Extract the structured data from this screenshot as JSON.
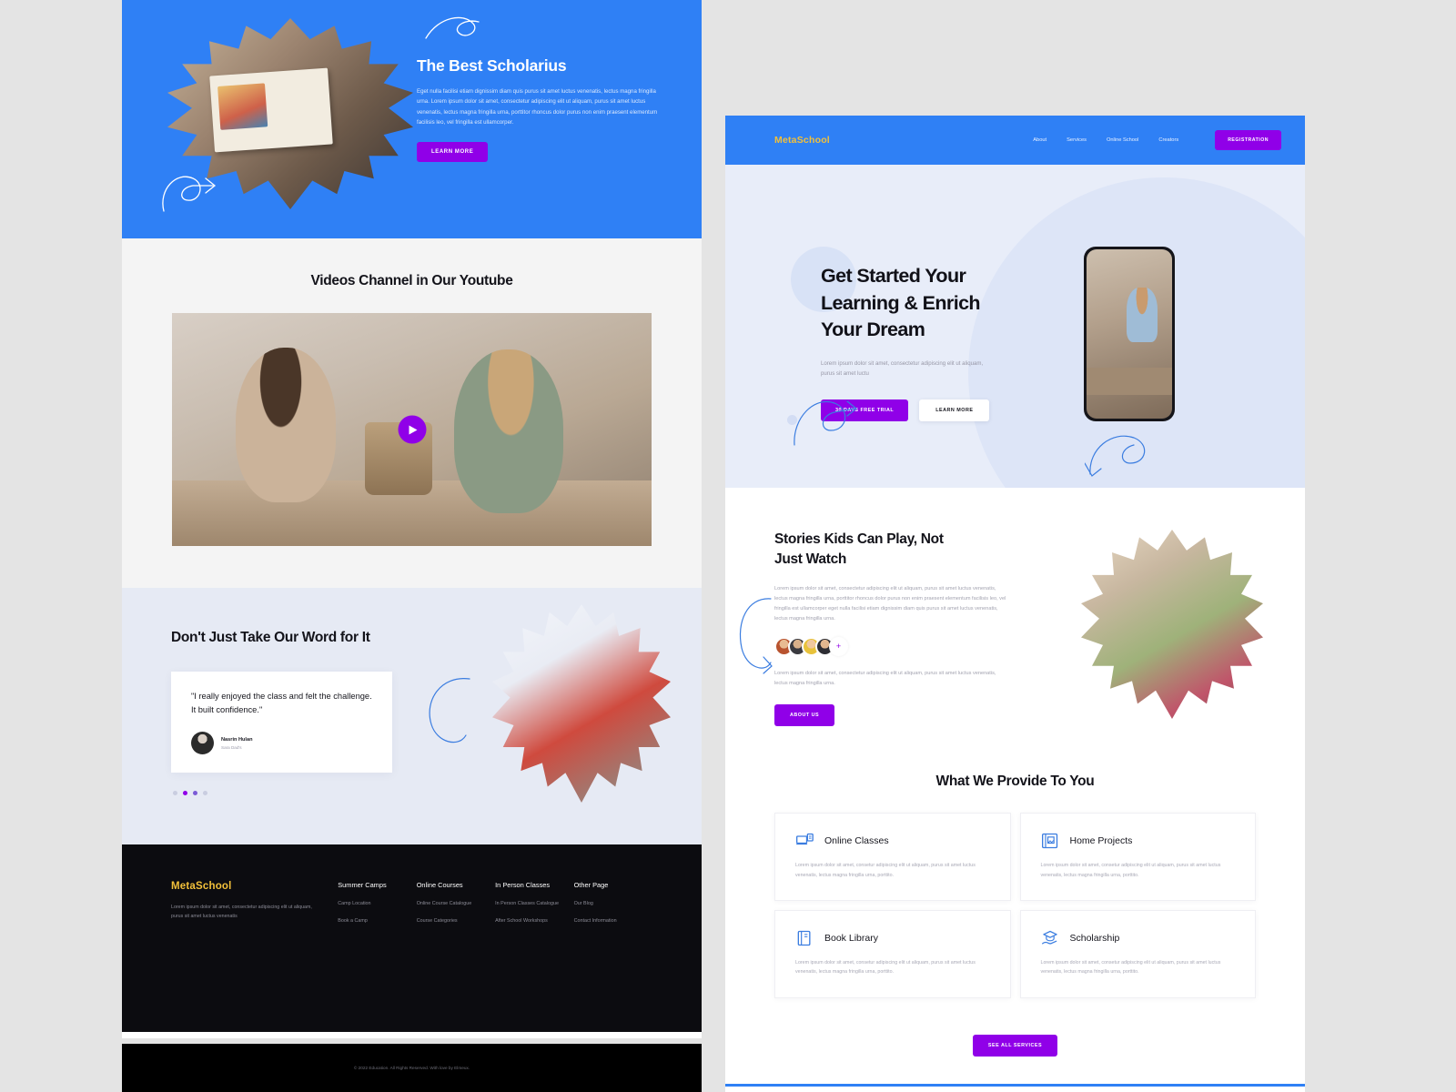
{
  "brand": {
    "name": "MetaSchool",
    "accent_yellow": "#f2c03a",
    "blue": "#2f80f5",
    "purple": "#9000e8"
  },
  "left_page": {
    "hero": {
      "title": "The Best Scholarius",
      "body": "Eget nulla facilisi etiam dignissim diam quis purus sit amet luctus venenatis, lectus magna fringilla urna. Lorem ipsum dolor sit amet, consectetur adipiscing elit ut aliquam, purus sit amet luctus venenatis, lectus magna fringilla urna, porttitor rhoncus dolor purus non enim praesent elementum facilisis leo, vel fringilla est ullamcorper.",
      "cta": "LEARN MORE"
    },
    "videos": {
      "title": "Videos Channel in Our Youtube",
      "play_label": "play-video"
    },
    "testimonials": {
      "title": "Don't Just Take Our\nWord for It",
      "quote": "\"I really enjoyed the class and felt the challenge.  It built confidence.\"",
      "author_name": "Nasrin Hulan",
      "author_role": "Sara Dad's",
      "dots": [
        "inactive",
        "active",
        "mid",
        "inactive"
      ]
    },
    "footer": {
      "brand": "MetaSchool",
      "description": "Lorem ipsum dolor sit amet, consectetur adipiscing elit ut aliquam, purus sit amet luctus venenatis",
      "columns": [
        {
          "title": "Summer Camps",
          "links": [
            "Camp Location",
            "Book a Camp"
          ]
        },
        {
          "title": "Online Courses",
          "links": [
            "Online Course Catalogue",
            "Course Categories"
          ]
        },
        {
          "title": "In Person Classes",
          "links": [
            "In Person Classes Catalogue",
            "After School Workshops"
          ]
        },
        {
          "title": "Other Page",
          "links": [
            "Our Blog",
            "Contact Information"
          ]
        }
      ],
      "copyright": "© 2022 Education. All Rights Reserved. With love by Elmeux."
    }
  },
  "right_page": {
    "nav": {
      "brand": "MetaSchool",
      "links": [
        "About",
        "Services",
        "Online School",
        "Creators"
      ],
      "cta": "REGISTRATION"
    },
    "hero": {
      "title": "Get Started Your Learning & Enrich Your Dream",
      "title_line1": "Get Started Your",
      "title_line2": "Learning & Enrich",
      "title_line3": "Your Dream",
      "sub": "Lorem ipsum dolor sit amet, consectetur adipiscing elit ut aliquam, purus sit amet luctu",
      "cta_primary": "30 DAYS FREE TRIAL",
      "cta_secondary": "LEARN MORE"
    },
    "stories": {
      "title_line1": "Stories Kids Can Play, Not",
      "title_line2": "Just Watch",
      "paragraph1": "Lorem ipsum dolor sit amet, consectetur adipiscing elit ut aliquam, purus sit amet luctus venenatis, lectus magna fringilla urna, porttitor rhoncus dolor purus non enim praesent elementum facilisis leo, vel fringilla est ullamcorper eget nulla facilisi etiam dignissim diam quis purus sit amet luctus venenatis, lectus magna fringilla urna.",
      "paragraph2": "Lorem ipsum dolor sit amet, consectetur adipiscing elit ut aliquam, purus sit amet luctus venenatis, lectus magna fringilla urna.",
      "avatar_more": "+",
      "cta": "ABOUT US"
    },
    "provide": {
      "title": "What We Provide To You",
      "cards": [
        {
          "icon": "laptop-classes-icon",
          "title": "Online Classes",
          "body": "Lorem ipsum dolor sit amet, consetur adipiscing elit ut aliquam, purus sit amet luctus venenatis, lectus magna fringilla urna, porttito."
        },
        {
          "icon": "home-projects-icon",
          "title": "Home Projects",
          "body": "Lorem ipsum dolor sit amet, consetur adipiscing elit ut aliquam, purus sit amet luctus venenatis, lectus magna fringilla urna, porttito."
        },
        {
          "icon": "book-library-icon",
          "title": "Book Library",
          "body": "Lorem ipsum dolor sit amet, consetur adipiscing elit ut aliquam, purus sit amet luctus venenatis, lectus magna fringilla urna, porttito."
        },
        {
          "icon": "scholarship-icon",
          "title": "Scholarship",
          "body": "Lorem ipsum dolor sit amet, consetur adipiscing elit ut aliquam, purus sit amet luctus venenatis, lectus magna fringilla urna, porttito."
        }
      ],
      "see_all": "SEE ALL SERVICES"
    }
  }
}
